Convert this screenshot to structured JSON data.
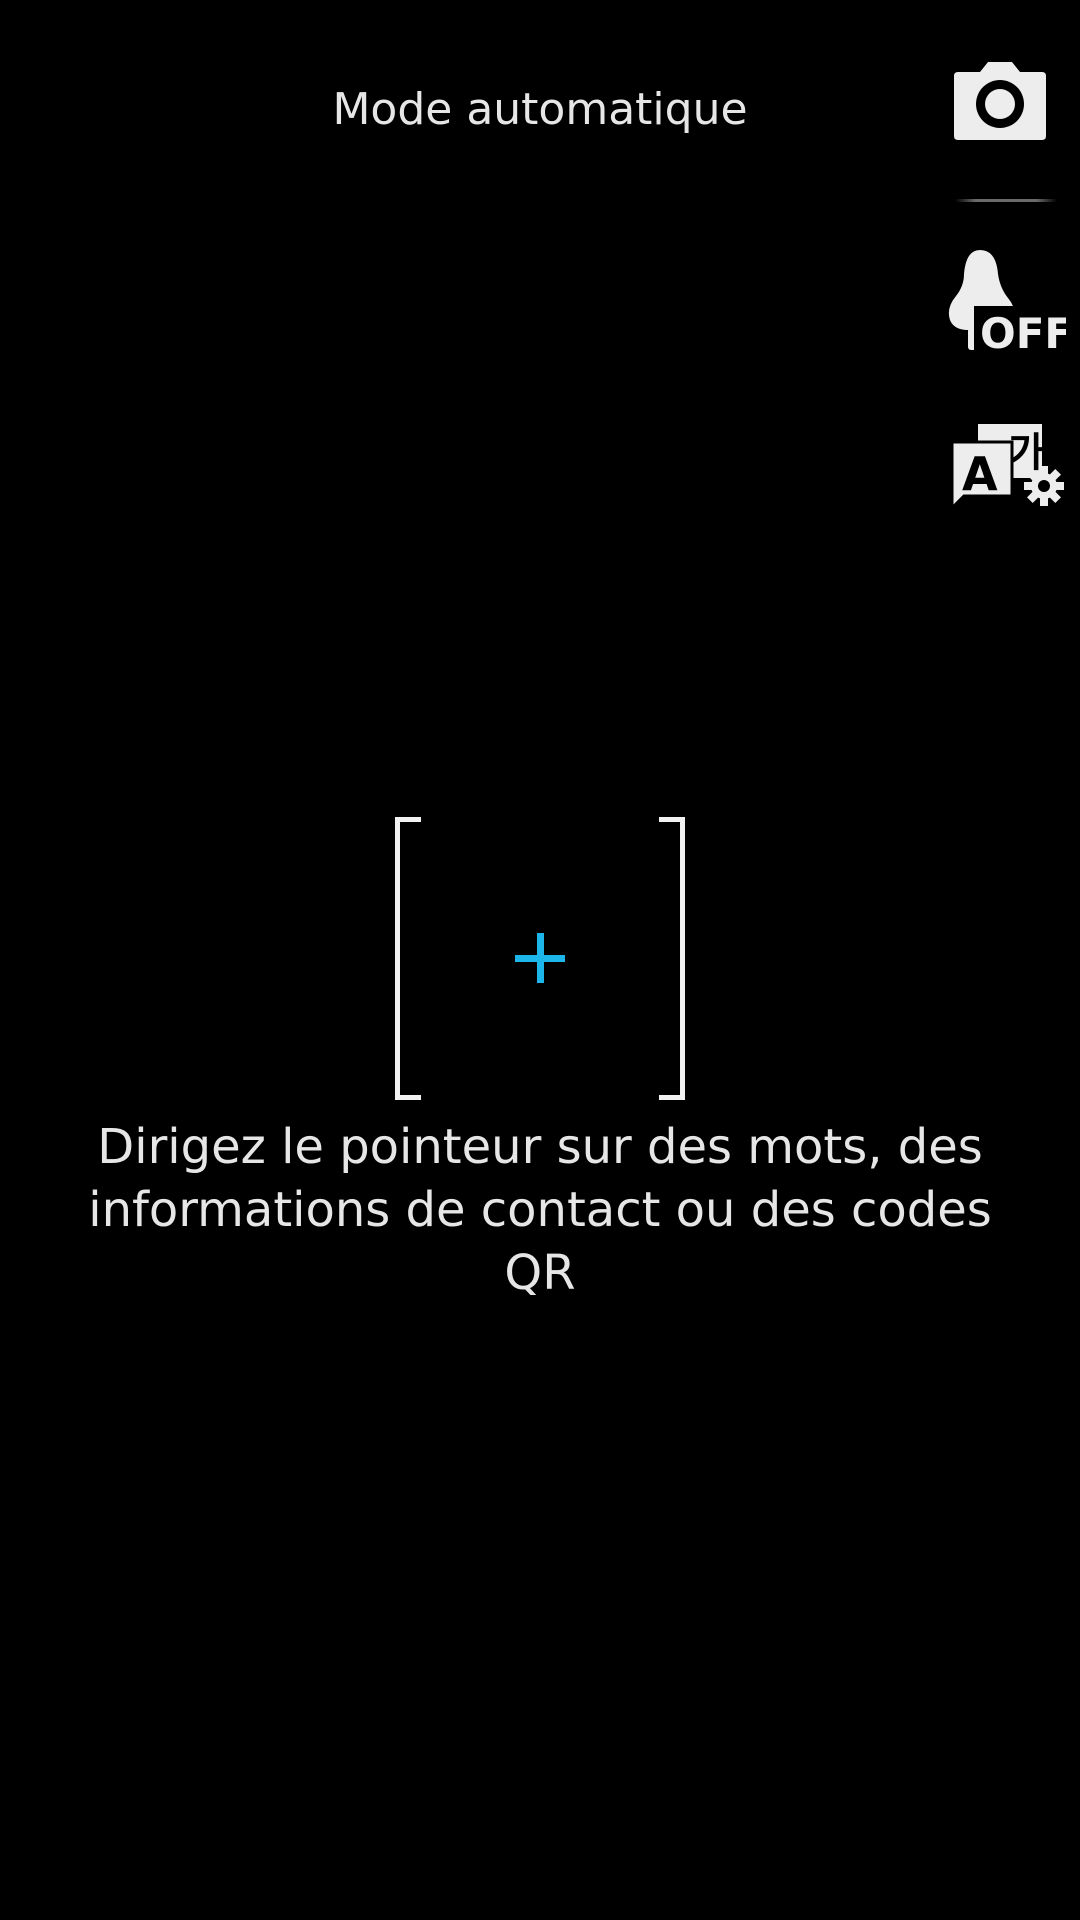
{
  "header": {
    "mode_label": "Mode automatique"
  },
  "toolbar": {
    "camera_icon": "camera-icon",
    "flash_icon": "flash-off-icon",
    "flash_state_label": "OFF",
    "translate_icon": "translate-settings-icon",
    "translate_glyph_latin": "A",
    "translate_glyph_hangul": "가"
  },
  "viewfinder": {
    "hint_text": "Dirigez le pointeur sur des mots, des informations de contact ou des codes QR"
  },
  "colors": {
    "background": "#000000",
    "text": "#e6e6e6",
    "crosshair": "#1cb6ea",
    "bracket": "#f2f2f2"
  }
}
